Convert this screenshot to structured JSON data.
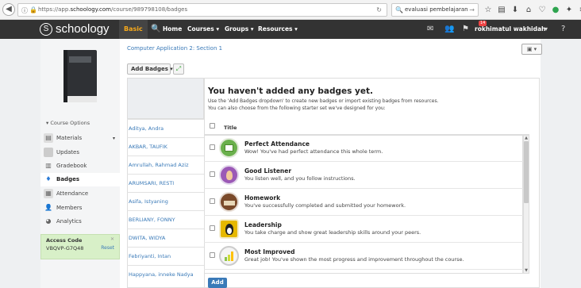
{
  "browser": {
    "url_prefix": "https://app.",
    "url_domain": "schoology.com",
    "url_path": "/course/989798108/badges",
    "search_query": "evaluasi pembelajaran"
  },
  "topnav": {
    "logo": "schoology",
    "basic": "Basic",
    "home": "Home",
    "courses": "Courses ▾",
    "groups": "Groups ▾",
    "resources": "Resources ▾",
    "notif_count": "14",
    "username": "rokhimatul wakhidah"
  },
  "sidebar": {
    "course_options": "Course Options",
    "items": [
      {
        "label": "Materials",
        "icon": "materials-icon"
      },
      {
        "label": "Updates",
        "icon": "updates-icon"
      },
      {
        "label": "Gradebook",
        "icon": "gradebook-icon"
      },
      {
        "label": "Badges",
        "icon": "badge-icon"
      },
      {
        "label": "Attendance",
        "icon": "attendance-icon"
      },
      {
        "label": "Members",
        "icon": "members-icon"
      },
      {
        "label": "Analytics",
        "icon": "analytics-icon"
      }
    ],
    "access_code_title": "Access Code",
    "access_code": "VBQVP-G7Q48",
    "reset": "Reset"
  },
  "main": {
    "breadcrumb": "Computer Application 2: Section 1",
    "add_badges": "Add Badges ▾",
    "heading": "You haven't added any badges yet.",
    "desc1": "Use the 'Add Badges dropdown' to create new badges or import existing badges from resources.",
    "desc2": "You can also choose from the following starter set we've designed for you:",
    "title_header": "Title",
    "add_button": "Add"
  },
  "students": [
    "Aditya, Andra",
    "AKBAR, TAUFIK",
    "Amrullah, Rahmad Aziz",
    "ARUMSARI, RESTI",
    "Asifa, Istyaning",
    "BERLIANY, FONNY",
    "DWITA, WIDYA",
    "Febriyanti, Intan",
    "Happyana, inneke Nadya"
  ],
  "badges": [
    {
      "name": "Perfect Attendance",
      "desc": "Wow! You've had perfect attendance this whole term.",
      "color": "#6ab04c"
    },
    {
      "name": "Good Listener",
      "desc": "You listen well, and you follow instructions.",
      "color": "#9b59b6"
    },
    {
      "name": "Homework",
      "desc": "You've successfully completed and submitted your homework.",
      "color": "#7a4a2a"
    },
    {
      "name": "Leadership",
      "desc": "You take charge and show great leadership skills around your peers.",
      "color": "#e6b800"
    },
    {
      "name": "Most Improved",
      "desc": "Great job! You've shown the most progress and improvement throughout the course.",
      "color": "#dddddd"
    }
  ]
}
